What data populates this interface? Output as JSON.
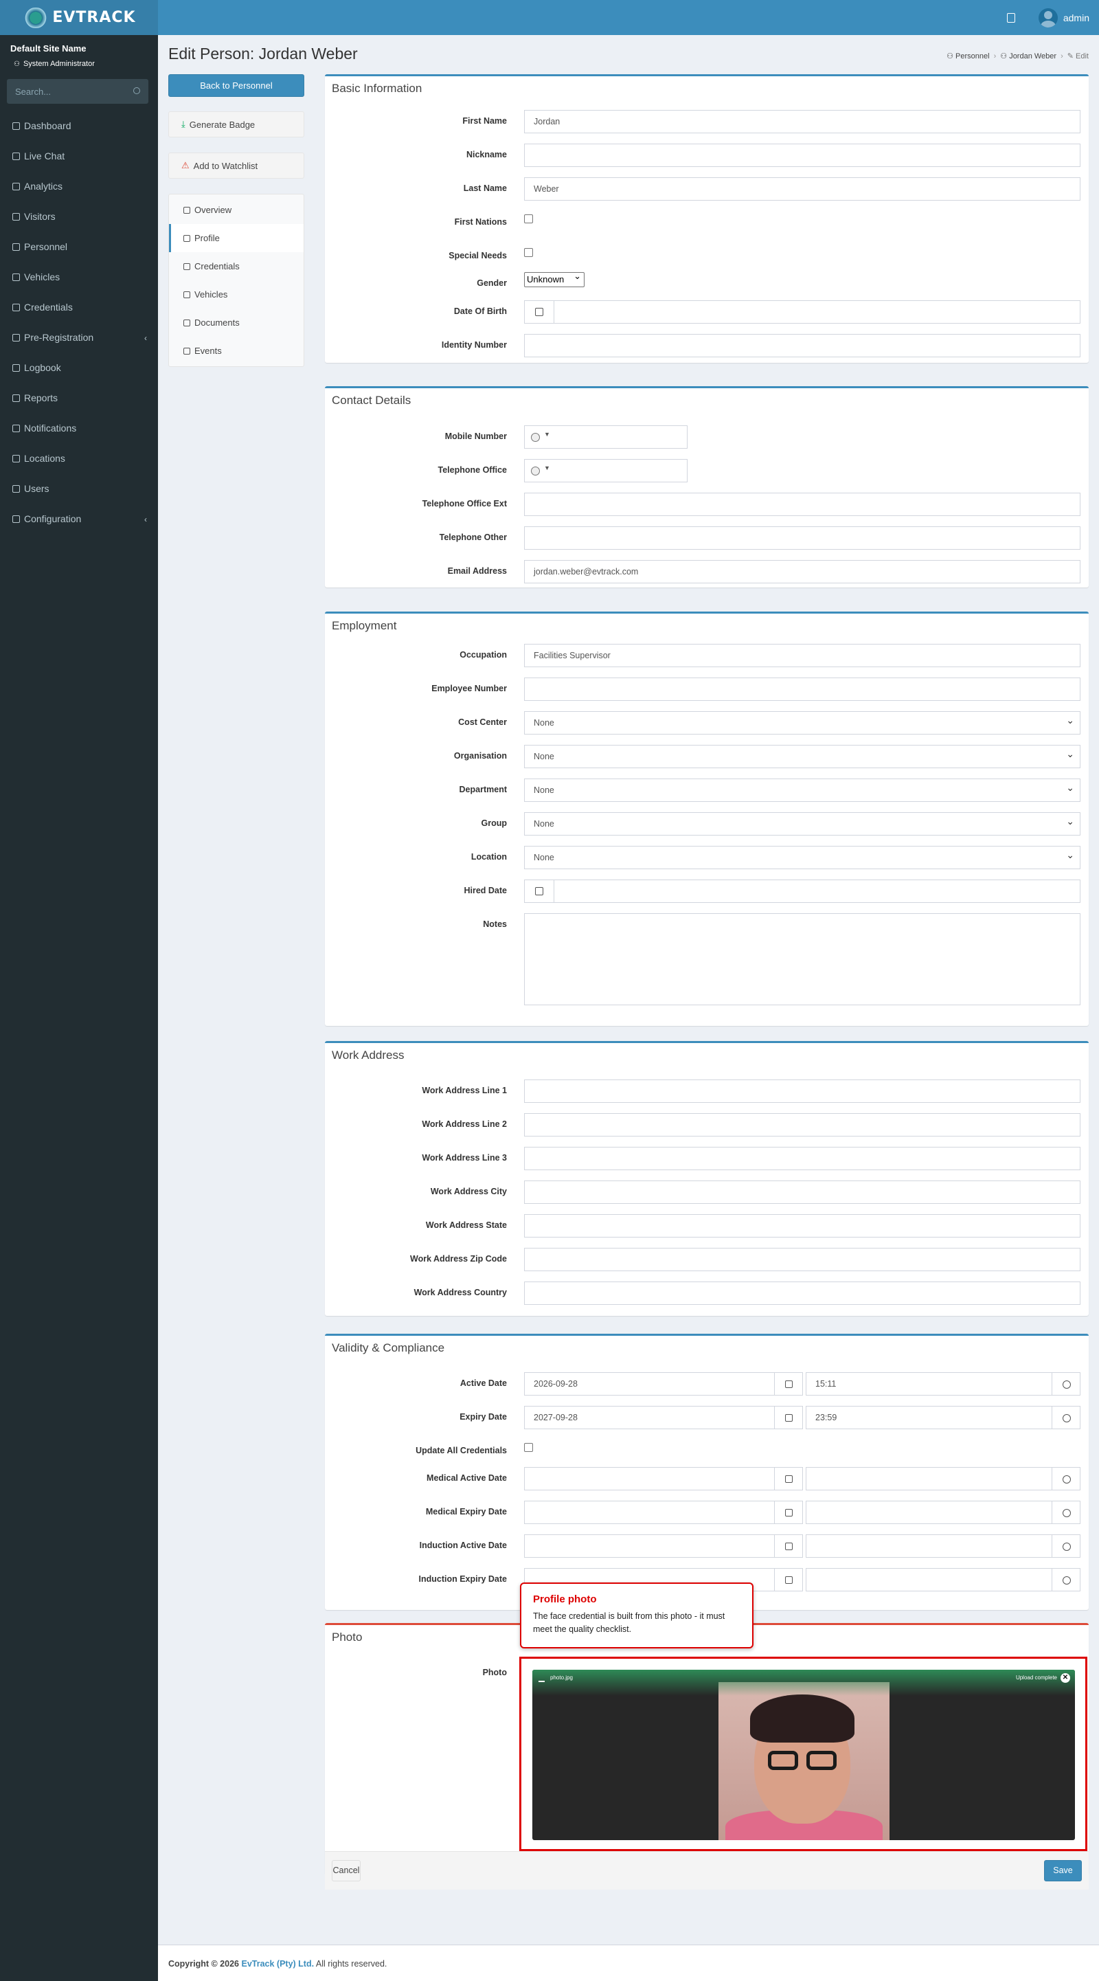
{
  "header": {
    "logo_text": "EVTRACK",
    "user": "admin"
  },
  "sidebar": {
    "site_name": "Default Site Name",
    "role": "System Administrator",
    "search_placeholder": "Search...",
    "items": [
      {
        "label": "Dashboard",
        "icon": "dashboard-icon"
      },
      {
        "label": "Live Chat",
        "icon": "headset-icon"
      },
      {
        "label": "Analytics",
        "icon": "analytics-icon"
      },
      {
        "label": "Visitors",
        "icon": "eye-icon"
      },
      {
        "label": "Personnel",
        "icon": "people-icon"
      },
      {
        "label": "Vehicles",
        "icon": "car-icon"
      },
      {
        "label": "Credentials",
        "icon": "id-card-icon"
      },
      {
        "label": "Pre-Registration",
        "icon": "link-icon",
        "arrow": "‹"
      },
      {
        "label": "Logbook",
        "icon": "book-icon"
      },
      {
        "label": "Reports",
        "icon": "chart-icon"
      },
      {
        "label": "Notifications",
        "icon": "bell-icon"
      },
      {
        "label": "Locations",
        "icon": "building-icon"
      },
      {
        "label": "Users",
        "icon": "users-icon"
      },
      {
        "label": "Configuration",
        "icon": "gear-icon",
        "arrow": "‹"
      }
    ]
  },
  "page": {
    "title": "Edit Person: Jordan Weber",
    "breadcrumb": [
      "Personnel",
      "Jordan Weber",
      "Edit"
    ]
  },
  "actions": {
    "back": "Back to Personnel",
    "badge": "Generate Badge",
    "watchlist": "Add to Watchlist"
  },
  "tabs": [
    "Overview",
    "Profile",
    "Credentials",
    "Vehicles",
    "Documents",
    "Events"
  ],
  "sections": {
    "basic": {
      "title": "Basic Information",
      "first_name_label": "First Name",
      "first_name": "Jordan",
      "nickname_label": "Nickname",
      "last_name_label": "Last Name",
      "last_name": "Weber",
      "first_nations_label": "First Nations",
      "special_needs_label": "Special Needs",
      "gender_label": "Gender",
      "gender": "Unknown",
      "dob_label": "Date Of Birth",
      "id_label": "Identity Number"
    },
    "contact": {
      "title": "Contact Details",
      "mobile_label": "Mobile Number",
      "tel_office_label": "Telephone Office",
      "tel_ext_label": "Telephone Office Ext",
      "tel_other_label": "Telephone Other",
      "email_label": "Email Address",
      "email": "jordan.weber@evtrack.com"
    },
    "employment": {
      "title": "Employment",
      "occupation_label": "Occupation",
      "occupation": "Facilities Supervisor",
      "employee_no_label": "Employee Number",
      "cost_center_label": "Cost Center",
      "cost_center": "None",
      "organisation_label": "Organisation",
      "organisation": "None",
      "department_label": "Department",
      "department": "None",
      "group_label": "Group",
      "group": "None",
      "location_label": "Location",
      "location": "None",
      "hired_label": "Hired Date",
      "notes_label": "Notes"
    },
    "work_address": {
      "title": "Work Address",
      "line1": "Work Address Line 1",
      "line2": "Work Address Line 2",
      "line3": "Work Address Line 3",
      "city": "Work Address City",
      "state": "Work Address State",
      "zip": "Work Address Zip Code",
      "country": "Work Address Country"
    },
    "validity": {
      "title": "Validity & Compliance",
      "active_label": "Active Date",
      "active_date": "2026-09-28",
      "active_time": "15:11",
      "expiry_label": "Expiry Date",
      "expiry_date": "2027-09-28",
      "expiry_time": "23:59",
      "update_creds_label": "Update All Credentials",
      "med_active_label": "Medical Active Date",
      "med_expiry_label": "Medical Expiry Date",
      "ind_active_label": "Induction Active Date",
      "ind_expiry_label": "Induction Expiry Date"
    },
    "photo": {
      "title": "Photo",
      "label": "Photo",
      "file_name": "photo.jpg",
      "status": "Upload complete",
      "tooltip_title": "Profile photo",
      "tooltip_body": "The face credential is built from this photo - it must meet the quality checklist."
    }
  },
  "footer": {
    "cancel": "Cancel",
    "save": "Save"
  },
  "copyright": {
    "prefix": "Copyright © 2026",
    "company": "EvTrack (Pty) Ltd.",
    "suffix": "All rights reserved."
  }
}
